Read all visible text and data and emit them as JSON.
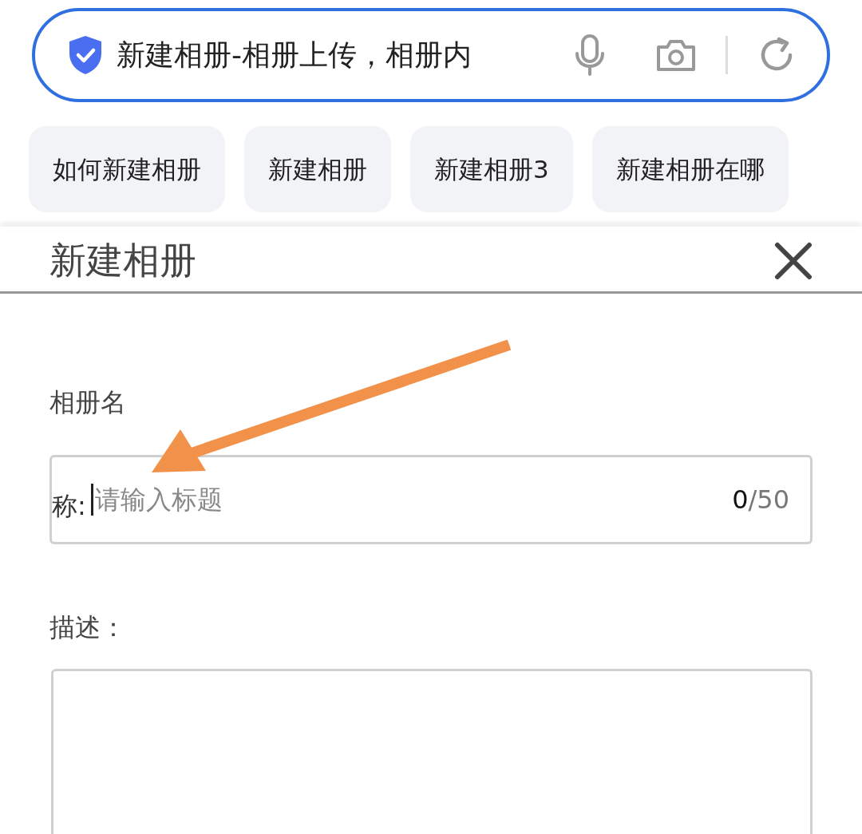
{
  "search_bar": {
    "text": "新建相册-相册上传，相册内"
  },
  "suggestions": [
    {
      "label": "如何新建相册"
    },
    {
      "label": "新建相册"
    },
    {
      "label": "新建相册3"
    },
    {
      "label": "新建相册在哪"
    }
  ],
  "dialog": {
    "title": "新建相册",
    "fields": [
      {
        "kind": "input",
        "label": "相册名",
        "label_overflow": "称:",
        "placeholder": "请输入标题",
        "count": "0",
        "max": "/50"
      },
      {
        "kind": "textarea",
        "label": "描述："
      }
    ]
  }
}
